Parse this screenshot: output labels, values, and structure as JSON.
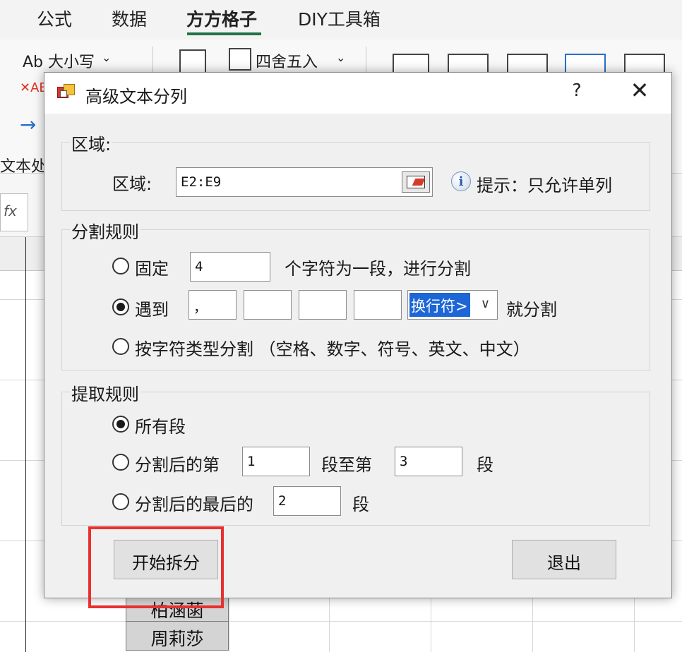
{
  "ribbon": {
    "tabs": [
      "公式",
      "数据",
      "方方格子",
      "DIY工具箱"
    ],
    "case_label": "Ab 大小写",
    "round_label": "四舍五入",
    "text_group_label": "文本处"
  },
  "sheet": {
    "visible_names": [
      "柏涵菡",
      "周莉莎"
    ]
  },
  "dialog": {
    "title": "高级文本分列",
    "help": "?",
    "close": "✕",
    "region_group": {
      "label": "区域:",
      "field_label": "区域:",
      "value": "E2:E9",
      "hint": "提示：只允许单列"
    },
    "split_group": {
      "label": "分割规则",
      "fixed_label": "固定",
      "fixed_value": "4",
      "fixed_suffix": "个字符为一段，进行分割",
      "meet_label": "遇到",
      "meet_values": [
        "，",
        "",
        "",
        ""
      ],
      "meet_select": "换行符>",
      "meet_suffix": "就分割",
      "type_label": "按字符类型分割 （空格、数字、符号、英文、中文）",
      "selected": "meet"
    },
    "extract_group": {
      "label": "提取规则",
      "all_label": "所有段",
      "range_label": "分割后的第",
      "range_from": "1",
      "range_mid": "段至第",
      "range_to": "3",
      "range_suffix": "段",
      "last_label": "分割后的最后的",
      "last_value": "2",
      "last_suffix": "段",
      "selected": "all"
    },
    "start_button": "开始拆分",
    "exit_button": "退出"
  },
  "colors": {
    "highlight": "#e8302e",
    "selection": "#1c66d6",
    "tab_underline": "#217346"
  }
}
